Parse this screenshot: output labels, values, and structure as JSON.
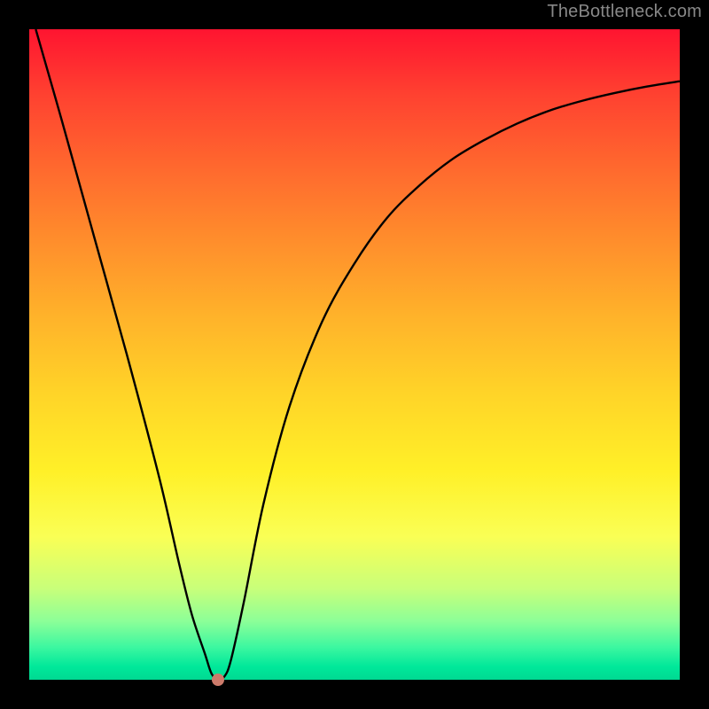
{
  "watermark": "TheBottleneck.com",
  "chart_data": {
    "type": "line",
    "title": "",
    "xlabel": "",
    "ylabel": "",
    "xlim": [
      0,
      100
    ],
    "ylim": [
      0,
      100
    ],
    "grid": false,
    "legend": false,
    "background_gradient": [
      "#ff1430",
      "#ffd428",
      "#00d992"
    ],
    "series": [
      {
        "name": "bottleneck-curve",
        "color": "#000000",
        "x": [
          1,
          5,
          10,
          15,
          20,
          23,
          25,
          27,
          28,
          29,
          30,
          31,
          33,
          36,
          40,
          45,
          50,
          55,
          60,
          65,
          70,
          75,
          80,
          85,
          90,
          95,
          100
        ],
        "values": [
          100,
          86,
          68,
          50,
          31,
          18,
          10,
          4,
          1,
          0,
          0.5,
          3,
          12,
          27,
          42,
          55,
          64,
          71,
          76,
          80,
          83,
          85.5,
          87.5,
          89,
          90.2,
          91.2,
          92
        ]
      }
    ],
    "marker": {
      "name": "current-config",
      "x": 29,
      "y": 0,
      "color": "#cc7a6a"
    }
  }
}
